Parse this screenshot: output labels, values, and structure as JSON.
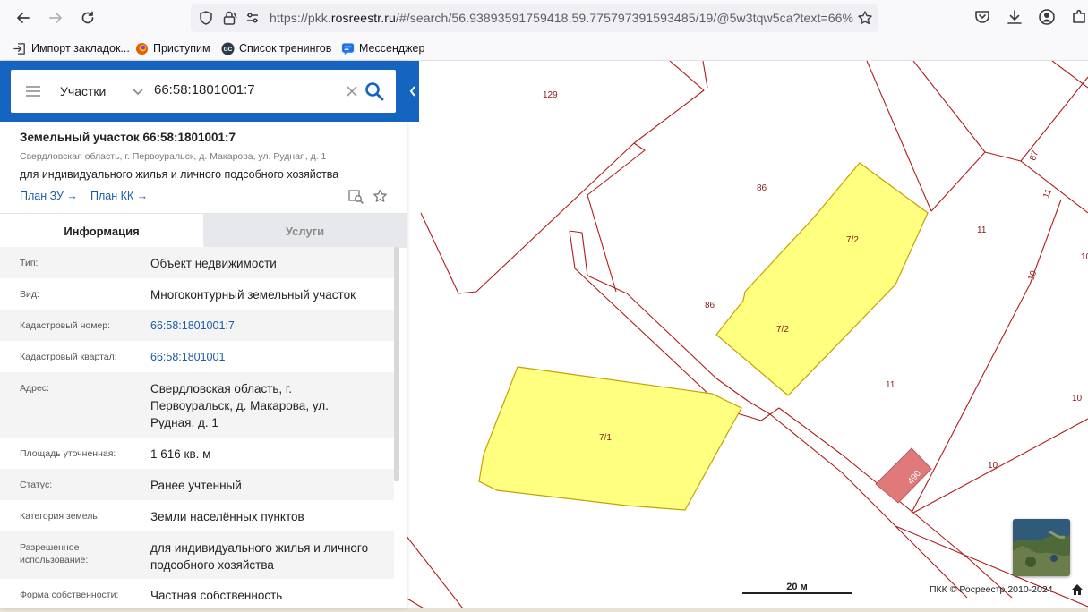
{
  "browser": {
    "url_prefix": "https://pkk.",
    "url_domain": "rosreestr.ru",
    "url_rest": "/#/search/56.93893591759418,59.775797391593485/19/@5w3tqw5ca?text=66%",
    "bookmarks": [
      {
        "label": "Импорт закладок..."
      },
      {
        "label": "Приступим"
      },
      {
        "label": "Список тренингов"
      },
      {
        "label": "Мессенджер"
      }
    ]
  },
  "search": {
    "scope": "Участки",
    "query": "66:58:1801001:7"
  },
  "object": {
    "title": "Земельный участок 66:58:1801001:7",
    "address": "Свердловская область, г. Первоуральск, д. Макарова, ул. Рудная, д. 1",
    "purpose": "для индивидуального жилья и личного подсобного хозяйства",
    "plan_zu": "План ЗУ →",
    "plan_kk": "План КК →"
  },
  "tabs": [
    {
      "label": "Информация"
    },
    {
      "label": "Услуги"
    }
  ],
  "info": [
    {
      "key": "Тип:",
      "value": "Объект недвижимости"
    },
    {
      "key": "Вид:",
      "value": "Многоконтурный земельный участок"
    },
    {
      "key": "Кадастровый номер:",
      "value": "66:58:1801001:7"
    },
    {
      "key": "Кадастровый квартал:",
      "value": "66:58:1801001"
    },
    {
      "key": "Адрес:",
      "value": "Свердловская область, г. Первоуральск, д. Макарова, ул. Рудная, д. 1"
    },
    {
      "key": "Площадь уточненная:",
      "value": "1 616 кв. м"
    },
    {
      "key": "Статус:",
      "value": "Ранее учтенный"
    },
    {
      "key": "Категория земель:",
      "value": "Земли населённых пунктов"
    },
    {
      "key": "Разрешенное использование:",
      "value": "для индивидуального жилья и личного подсобного хозяйства"
    },
    {
      "key": "Форма собственности:",
      "value": "Частная собственность"
    }
  ],
  "map": {
    "labels": [
      "129",
      "86",
      "86",
      "7/2",
      "7/2",
      "7/1",
      "11",
      "11",
      "11",
      "87",
      "10",
      "10",
      "10",
      "10",
      "490"
    ],
    "scale": "20 м",
    "copyright": "ПКК © Росреестр 2010-2024",
    "colors": {
      "boundary": "#b01c1c",
      "selected_fill": "#ffff80",
      "selected_stroke": "#c8a000",
      "building": "#e07a7a",
      "panel_blue": "#1565c0"
    }
  }
}
